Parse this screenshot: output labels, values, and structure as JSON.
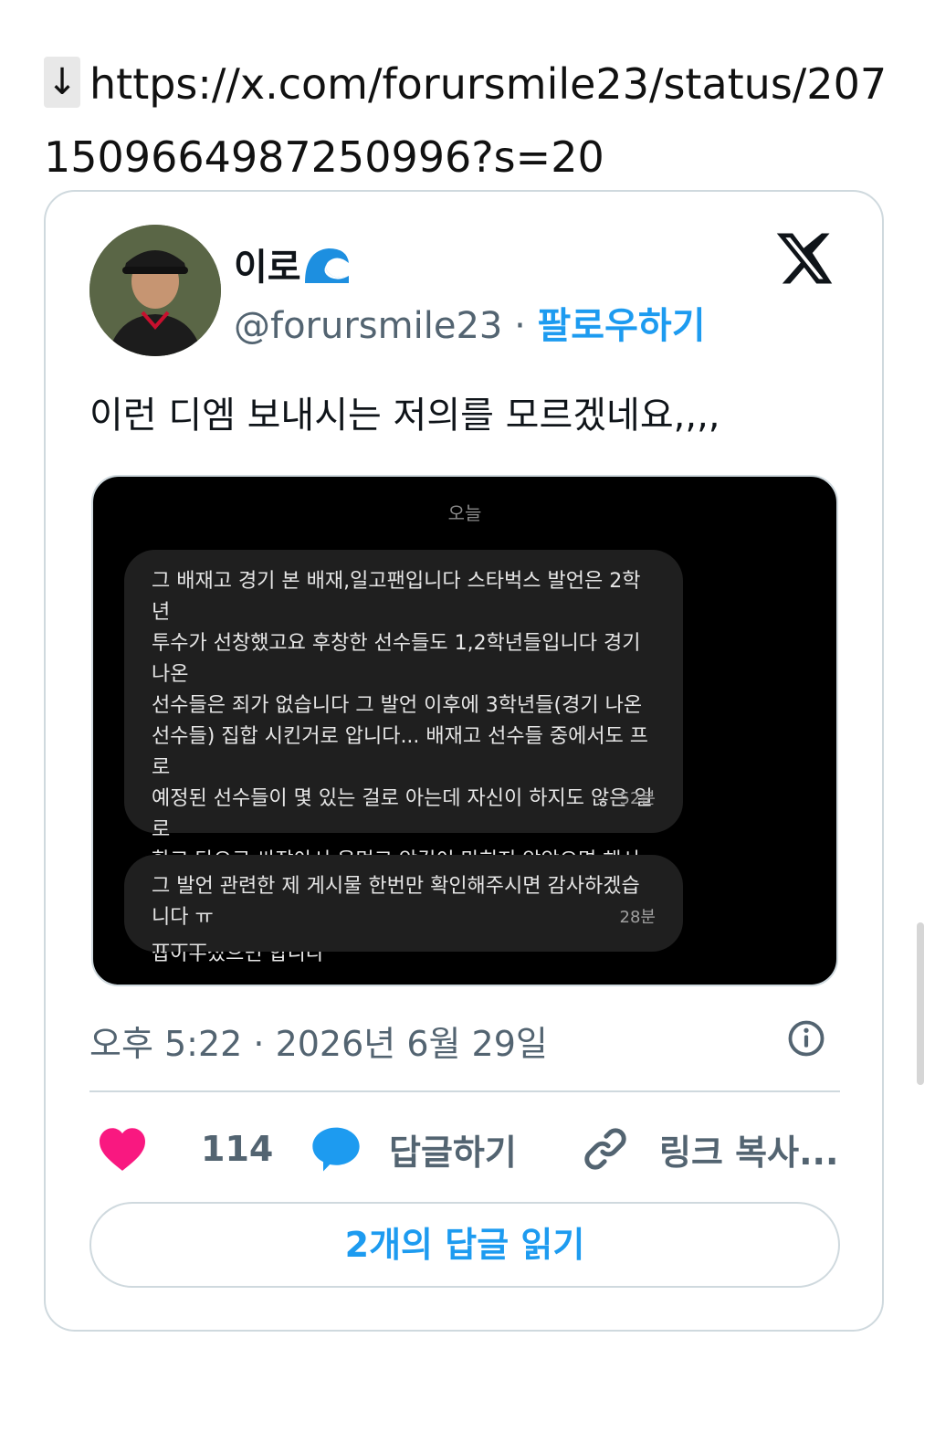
{
  "url": {
    "icon": "down-arrow-icon",
    "text": "https://x.com/forursmile23/status/2071509664987250996?s=20"
  },
  "tweet": {
    "display_name": "이로",
    "handle": "@forursmile23",
    "separator": "·",
    "follow_label": "팔로우하기",
    "text": "이런 디엠 보내시는 저의를 모르겠네요,,,,",
    "media": {
      "date_label": "오늘",
      "messages": [
        {
          "text": "그 배재고 경기 본 배재,일고팬입니다 스타벅스 발언은 2학년\n투수가 선창했고요 후창한 선수들도 1,2학년들입니다 경기 나온\n선수들은 죄가 없습니다 그 발언 이후에 3학년들(경기 나온\n선수들) 집합 시킨거로 압니다... 배재고 선수들 중에서도 프로\n예정된 선수들이 몇 있는 걸로 아는데 자신이 하지도 않은 일로\n학교 탓으로 싸잡아서 욕먹고 앞길이 막히지 않았으면 해서 제일\n반응 좋은 글 쓰신 이로님께 연락드립니다..!! 한 번만 바로\n잡아주셨으면 합니다",
          "time": "52분"
        },
        {
          "text": "그 발언 관련한 제 게시물 한번만 확인해주시면 감사하겠습니다 ㅠ\nㅠㅜㅜ",
          "time": "28분"
        }
      ]
    },
    "timestamp": "오후 5:22 · 2026년 6월 29일",
    "likes": "114",
    "reply_label": "답글하기",
    "copy_link_label": "링크 복사...",
    "read_replies_label": "2개의 답글 읽기"
  },
  "colors": {
    "accent": "#1d9bf0",
    "like": "#f91880",
    "muted": "#536471",
    "border": "#cfd9de"
  }
}
